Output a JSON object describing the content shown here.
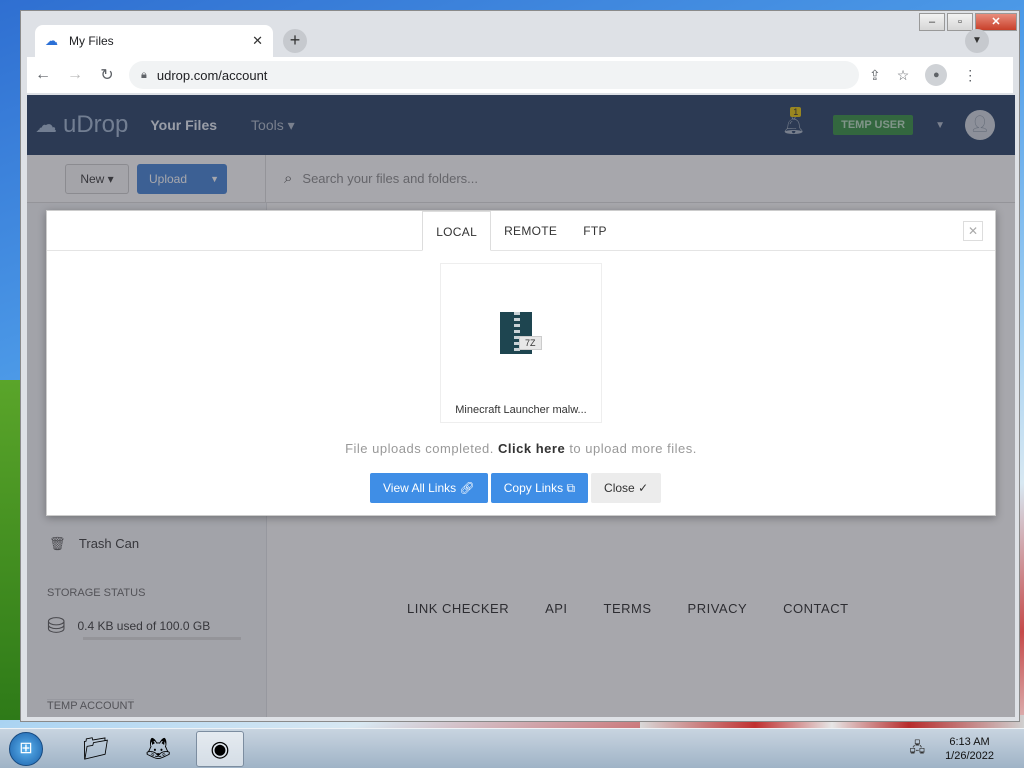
{
  "browser": {
    "tab_title": "My Files",
    "url": "udrop.com/account"
  },
  "site": {
    "logo": "uDrop",
    "nav_files": "Your Files",
    "nav_tools": "Tools",
    "notifications_count": "1",
    "user_label": "TEMP USER"
  },
  "toolbar": {
    "new_label": "New",
    "upload_label": "Upload",
    "search_placeholder": "Search your files and folders..."
  },
  "sidebar": {
    "trash": "Trash Can",
    "storage_title": "STORAGE STATUS",
    "storage_text": "0.4 KB used of 100.0 GB",
    "storage_used_fraction": 0.0,
    "temp_account": "TEMP ACCOUNT"
  },
  "footer": {
    "links": [
      "LINK CHECKER",
      "API",
      "TERMS",
      "PRIVACY",
      "CONTACT"
    ]
  },
  "modal": {
    "tabs": [
      "LOCAL",
      "REMOTE",
      "FTP"
    ],
    "active_tab": "LOCAL",
    "file_ext": "7Z",
    "file_name": "Minecraft Launcher malw...",
    "msg_prefix": "File uploads completed.",
    "msg_link": "Click here",
    "msg_suffix": "to upload more files.",
    "btn_view": "View All Links",
    "btn_copy": "Copy Links",
    "btn_close": "Close"
  },
  "taskbar": {
    "time": "6:13 AM",
    "date": "1/26/2022"
  },
  "colors": {
    "nav_bg": "#1f3a5f",
    "accent_blue": "#3f8ee6",
    "temp_user_green": "#2d8a3a"
  }
}
